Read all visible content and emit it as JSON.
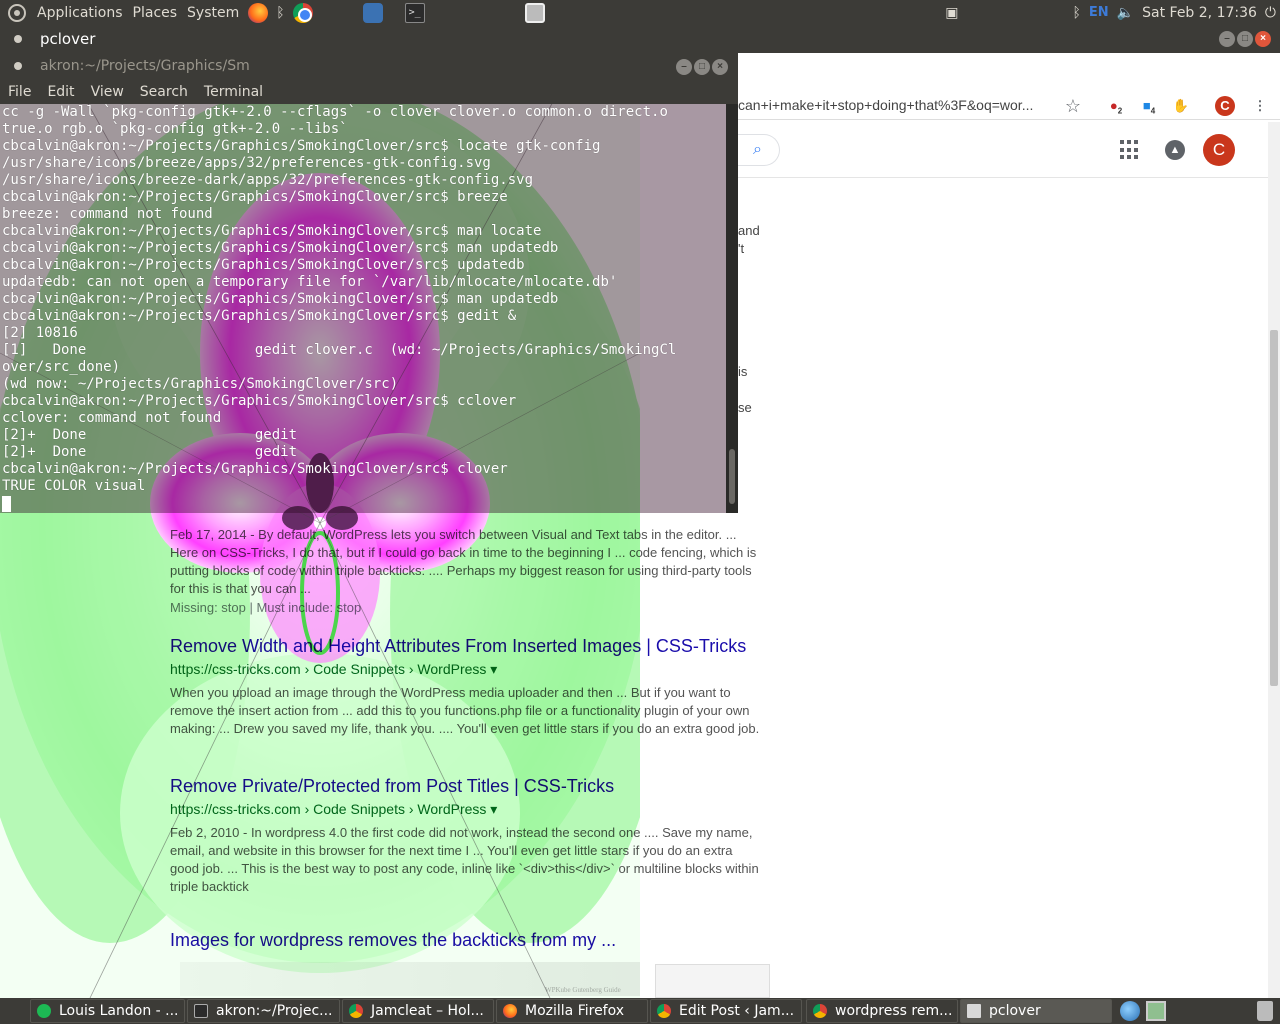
{
  "top_panel": {
    "menus": [
      "Applications",
      "Places",
      "System"
    ],
    "input_language": "EN",
    "clock": "Sat Feb 2, 17:36"
  },
  "pclover_window": {
    "title": "pclover"
  },
  "terminal": {
    "title": "akron:~/Projects/Graphics/Sm",
    "menus": [
      "File",
      "Edit",
      "View",
      "Search",
      "Terminal"
    ],
    "lines": [
      "cc -g -Wall `pkg-config gtk+-2.0 --cflags` -o clover clover.o common.o direct.o",
      "true.o rgb.o `pkg-config gtk+-2.0 --libs`",
      "cbcalvin@akron:~/Projects/Graphics/SmokingClover/src$ locate gtk-config",
      "/usr/share/icons/breeze/apps/32/preferences-gtk-config.svg",
      "/usr/share/icons/breeze-dark/apps/32/preferences-gtk-config.svg",
      "cbcalvin@akron:~/Projects/Graphics/SmokingClover/src$ breeze",
      "breeze: command not found",
      "cbcalvin@akron:~/Projects/Graphics/SmokingClover/src$ man locate",
      "cbcalvin@akron:~/Projects/Graphics/SmokingClover/src$ man updatedb",
      "cbcalvin@akron:~/Projects/Graphics/SmokingClover/src$ updatedb",
      "updatedb: can not open a temporary file for `/var/lib/mlocate/mlocate.db'",
      "cbcalvin@akron:~/Projects/Graphics/SmokingClover/src$ man updatedb",
      "cbcalvin@akron:~/Projects/Graphics/SmokingClover/src$ gedit &",
      "[2] 10816",
      "[1]   Done                    gedit clover.c  (wd: ~/Projects/Graphics/SmokingCl",
      "over/src_done)",
      "(wd now: ~/Projects/Graphics/SmokingClover/src)",
      "cbcalvin@akron:~/Projects/Graphics/SmokingClover/src$ cclover",
      "cclover: command not found",
      "[2]+  Done                    gedit",
      "[2]+  Done                    gedit",
      "cbcalvin@akron:~/Projects/Graphics/SmokingClover/src$ clover",
      "TRUE COLOR visual"
    ]
  },
  "chrome": {
    "omnibox_tail": "can+i+make+it+stop+doing+that%3F&oq=wor...",
    "star_icon": "☆",
    "ext_badge_1": "2",
    "ext_badge_2": "4",
    "profile_initial": "C",
    "account_initial": "C",
    "search_icon": "⌕",
    "fragments": [
      "and",
      "'t",
      "is",
      "se"
    ]
  },
  "results": [
    {
      "title": "",
      "url": "",
      "snippet": "Feb 17, 2014 - By default, WordPress lets you switch between Visual and Text tabs in the editor. ... Here on CSS-Tricks, I do that, but if I could go back in time to the beginning I ... code fencing, which is putting blocks of code within triple backticks: .... Perhaps my biggest reason for using third-party tools for this is that you can ...",
      "missing": "Missing: stop | Must include: stop"
    },
    {
      "title": "Remove Width and Height Attributes From Inserted Images | CSS-Tricks",
      "url": "https://css-tricks.com › Code Snippets › WordPress ▾",
      "snippet": "When you upload an image through the WordPress media uploader and then ... But if you want to remove the insert action from ... add this to you functions.php file or a functionality plugin of your own making: ... Drew you saved my life, thank you. .... You'll even get little stars if you do an extra good job.",
      "missing": ""
    },
    {
      "title": "Remove Private/Protected from Post Titles | CSS-Tricks",
      "url": "https://css-tricks.com › Code Snippets › WordPress ▾",
      "snippet": "Feb 2, 2010 - In wordpress 4.0 the first code did not work, instead the second one .... Save my name, email, and website in this browser for the next time I ... You'll even get little stars if you do an extra good job. ... This is the best way to post any code, inline like `<div>this</div>` or multiline blocks within triple backtick",
      "missing": ""
    },
    {
      "title": "Images for wordpress removes the backticks from my ...",
      "url": "",
      "snippet": "",
      "missing": ""
    }
  ],
  "image_strip": {
    "caption": "WPKube Gutenberg Guide"
  },
  "taskbar": {
    "items": [
      {
        "label": "Louis Landon - ...",
        "icon": "spotify-icon"
      },
      {
        "label": "akron:~/Projec...",
        "icon": "terminal-icon"
      },
      {
        "label": "Jamcleat – Hol...",
        "icon": "chrome-icon"
      },
      {
        "label": "Mozilla Firefox",
        "icon": "firefox-icon"
      },
      {
        "label": "Edit Post ‹ Jam...",
        "icon": "chrome-icon"
      },
      {
        "label": "wordpress rem...",
        "icon": "chrome-icon"
      },
      {
        "label": "pclover",
        "icon": "window-icon"
      }
    ]
  },
  "colors": {
    "panel": "#3c3b37",
    "fractal_magenta": "#ff00ff",
    "fractal_green": "#7dff7d",
    "link_blue": "#1a0dab",
    "url_green": "#006621"
  }
}
